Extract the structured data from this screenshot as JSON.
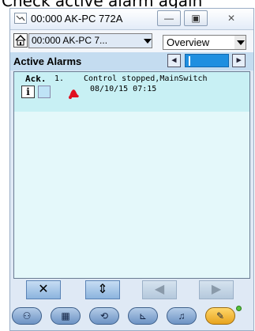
{
  "caption": "Check active alarm again",
  "window": {
    "title": "00:000 AK-PC 772A",
    "controls": {
      "minimize": "—",
      "maximize": "▣",
      "close": "✕"
    }
  },
  "toolbar": {
    "device": "00:000 AK-PC 7...",
    "view": "Overview"
  },
  "alarms": {
    "header": "Active Alarms",
    "prev": "◂",
    "next": "▸",
    "columns": {
      "ack": "Ack."
    },
    "items": [
      {
        "number": "1.",
        "info": "i",
        "text": "Control stopped,MainSwitch",
        "timestamp": "08/10/15 07:15"
      }
    ]
  },
  "actions": {
    "dismiss": "✕",
    "refresh": "⇕",
    "prev": "◀",
    "next": "▶"
  },
  "nav": {
    "items": [
      {
        "icon": "glasses-icon",
        "glyph": "⚇"
      },
      {
        "icon": "keypad-icon",
        "glyph": "▦"
      },
      {
        "icon": "tools-icon",
        "glyph": "⟲"
      },
      {
        "icon": "graph-icon",
        "glyph": "⊾"
      },
      {
        "icon": "alarm-bell-icon",
        "glyph": "♫"
      },
      {
        "icon": "wrench-icon",
        "glyph": "✎"
      }
    ]
  },
  "colors": {
    "alarm_bell": "#e01020",
    "header_bg": "#c4dcf0",
    "active_nav": "#e7a31e",
    "status_led": "#55c23a"
  }
}
